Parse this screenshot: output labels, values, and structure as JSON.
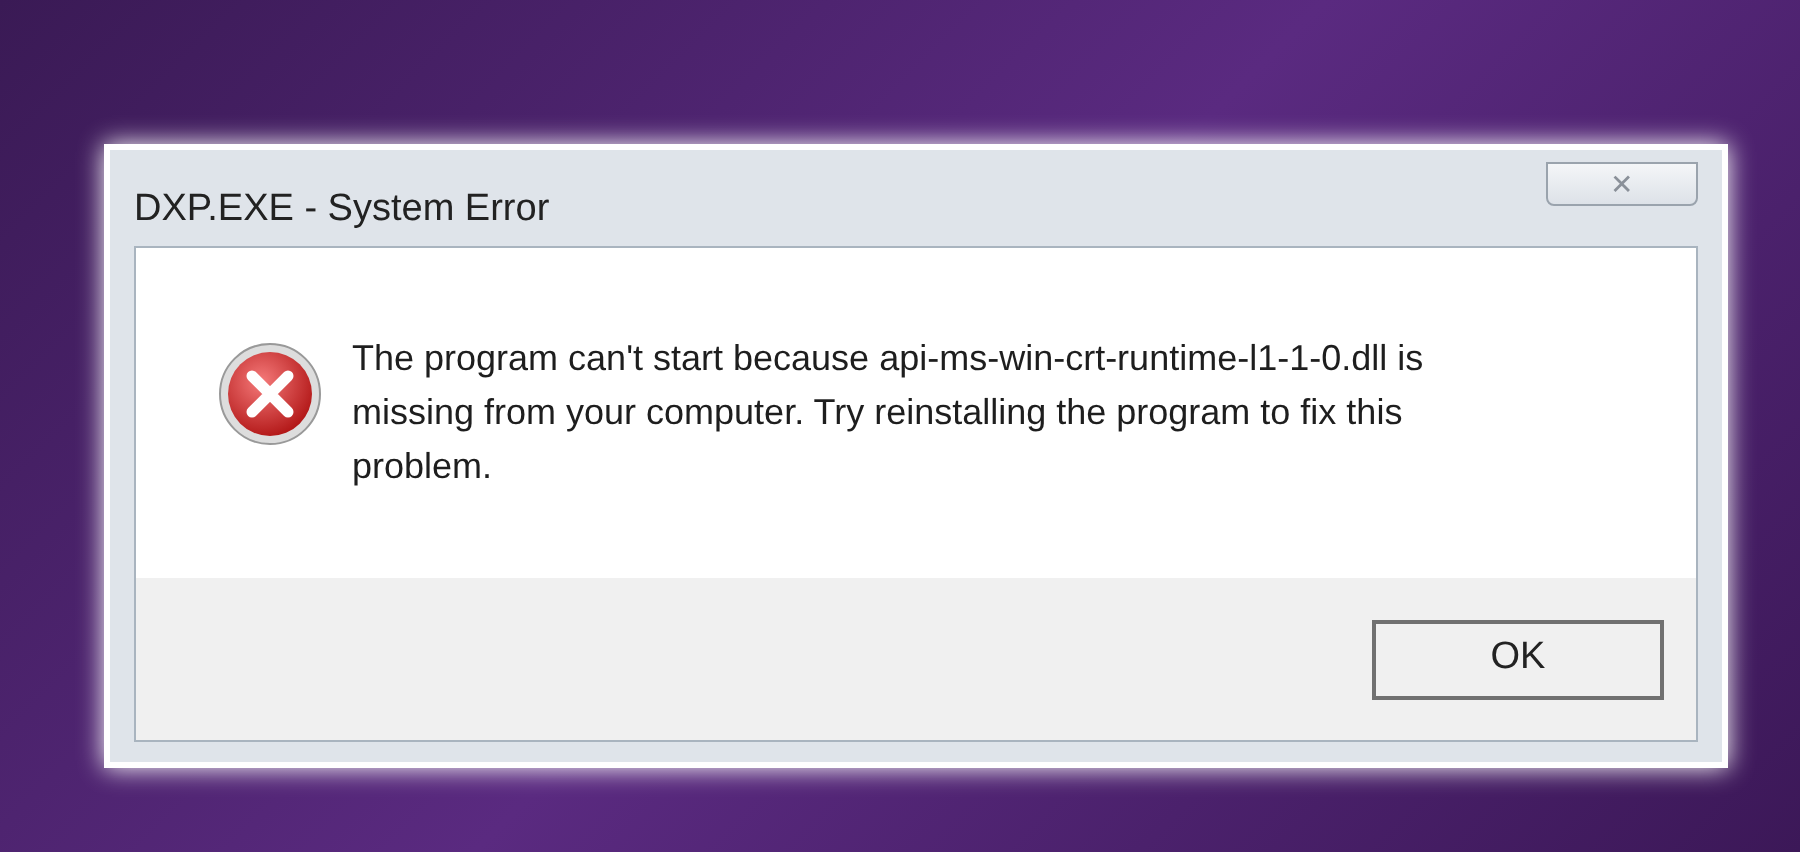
{
  "window": {
    "title": "DXP.EXE - System Error",
    "close_symbol": "✕"
  },
  "message": "The program can't start because api-ms-win-crt-runtime-l1-1-0.dll is missing from your computer. Try reinstalling the program to fix this problem.",
  "buttons": [
    "OK"
  ]
}
